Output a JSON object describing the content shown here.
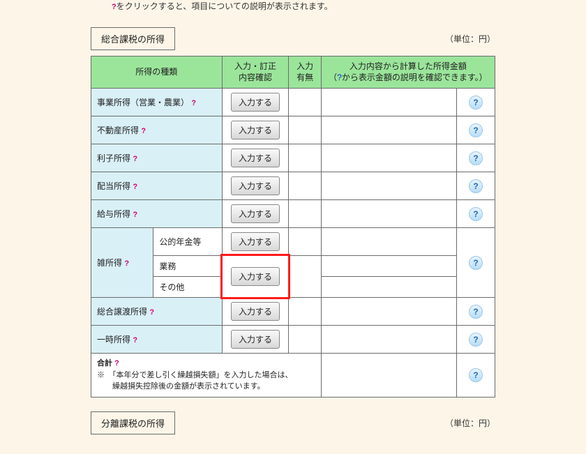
{
  "intro": {
    "line1_partial": "をクリックすると、項目についての説明が表示されます。"
  },
  "section1": {
    "title": "総合課税の所得",
    "unit": "（単位：円）"
  },
  "section2": {
    "title": "分離課税の所得",
    "unit": "（単位：円）"
  },
  "headers": {
    "col1": "所得の種類",
    "col2": "入力・訂正\n内容確認",
    "col3": "入力\n有無",
    "col4_line1": "入力内容から計算した所得金額",
    "col4_line2_before": "（",
    "col4_line2_link": "?",
    "col4_line2_after": "から表示金額の説明を確認できます。）"
  },
  "button_label": "入力する",
  "help_icon": "?",
  "q_mark": "?",
  "rows": {
    "r1": "事業所得（営業・農業）",
    "r2": "不動産所得",
    "r3": "利子所得",
    "r4": "配当所得",
    "r5": "給与所得",
    "r6_main": "雑所得",
    "r6a": "公的年金等",
    "r6b": "業務",
    "r6c": "その他",
    "r7": "総合譲渡所得",
    "r8": "一時所得"
  },
  "total": {
    "label": "合計",
    "note_line1": "※　「本年分で差し引く繰越損失額」を入力した場合は、",
    "note_line2": "　　繰越損失控除後の金額が表示されています。"
  }
}
